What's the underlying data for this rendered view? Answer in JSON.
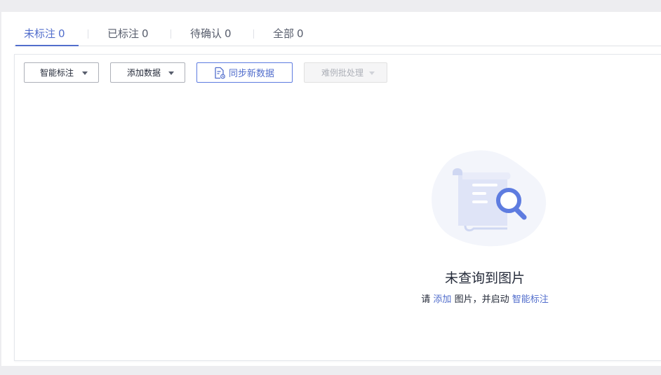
{
  "tabs": [
    {
      "label": "未标注",
      "count": "0"
    },
    {
      "label": "已标注",
      "count": "0"
    },
    {
      "label": "待确认",
      "count": "0"
    },
    {
      "label": "全部",
      "count": "0"
    }
  ],
  "toolbar": {
    "smart_label": "智能标注",
    "add_data": "添加数据",
    "sync_data": "同步新数据",
    "hard_example": "难例批处理"
  },
  "empty_state": {
    "title": "未查询到图片",
    "desc_prefix": "请",
    "desc_link_add": "添加",
    "desc_middle": "图片，并启动",
    "desc_link_smart": "智能标注"
  },
  "colors": {
    "accent": "#526ecc",
    "background": "#ededf0",
    "illustration_blob": "#f3f5fb"
  }
}
